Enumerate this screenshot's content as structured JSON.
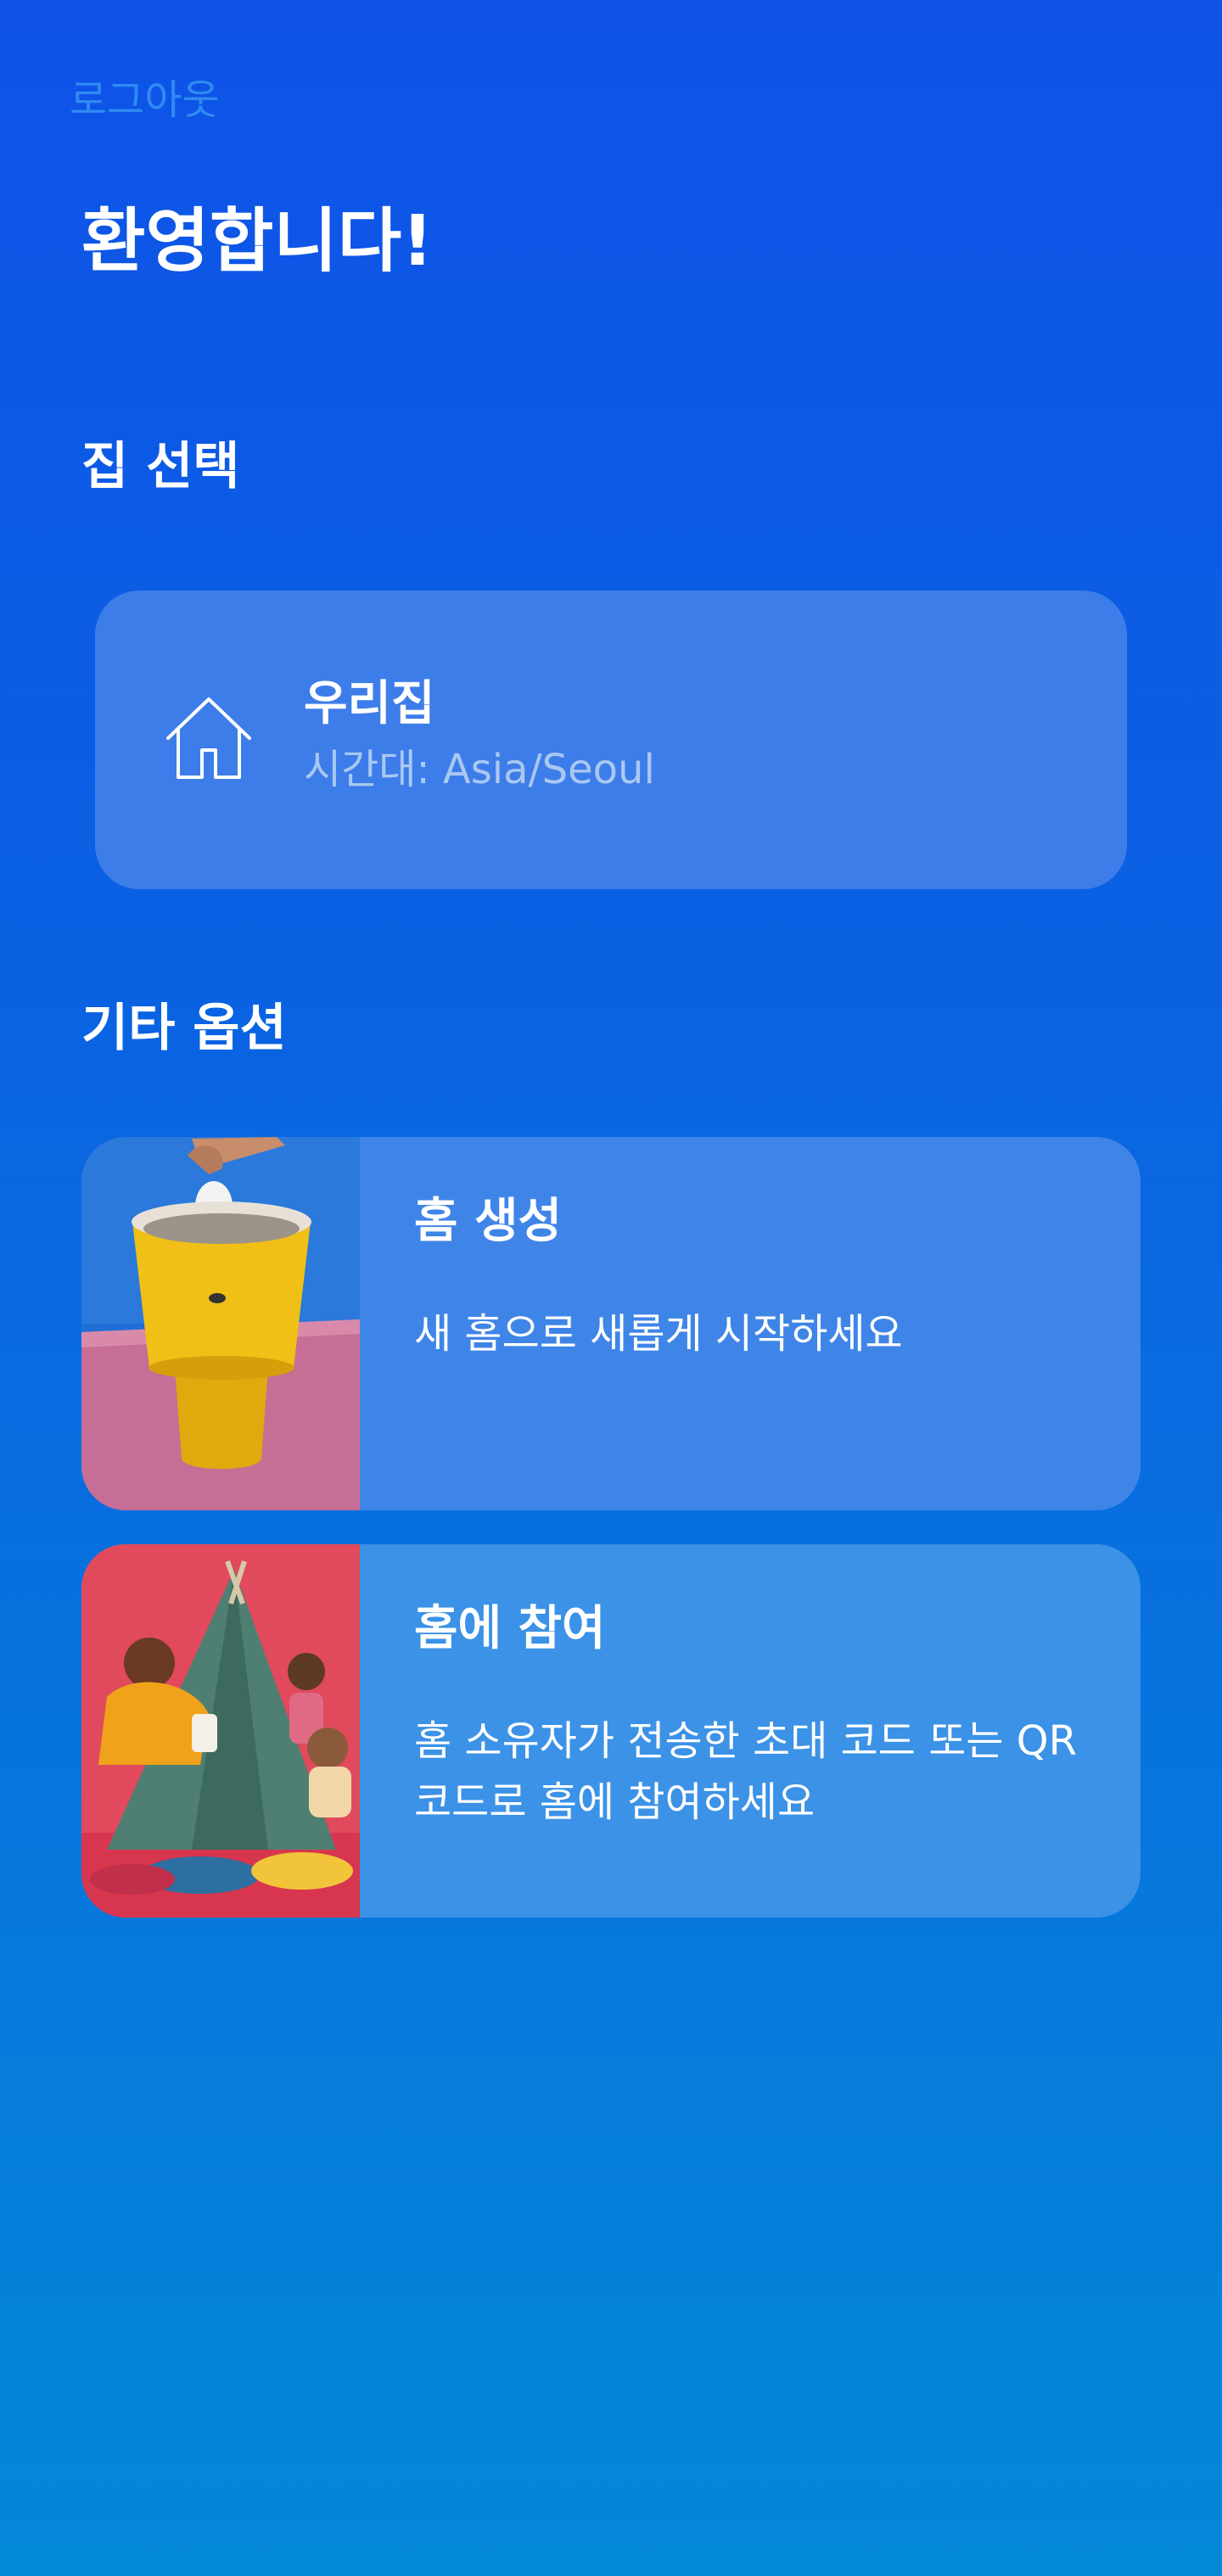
{
  "header": {
    "logout_label": "로그아웃",
    "welcome_title": "환영합니다!"
  },
  "home_select": {
    "section_title": "집 선택",
    "homes": [
      {
        "name": "우리집",
        "timezone": "시간대: Asia/Seoul",
        "icon": "house-icon"
      }
    ]
  },
  "other_options": {
    "section_title": "기타 옵션",
    "items": [
      {
        "title": "홈 생성",
        "description": "새 홈으로 새롭게 시작하세요",
        "image": "lamp-photo"
      },
      {
        "title": "홈에 참여",
        "description": "홈 소유자가 전송한 초대 코드 또는 QR 코드로 홈에 참여하세요",
        "image": "tent-kids-photo"
      }
    ]
  },
  "colors": {
    "background_top": "#0e52e8",
    "background_bottom": "#0488d8",
    "logout_link": "#2f8bf2",
    "card": "#3d7de9",
    "timezone_text": "#a9c8f2"
  }
}
